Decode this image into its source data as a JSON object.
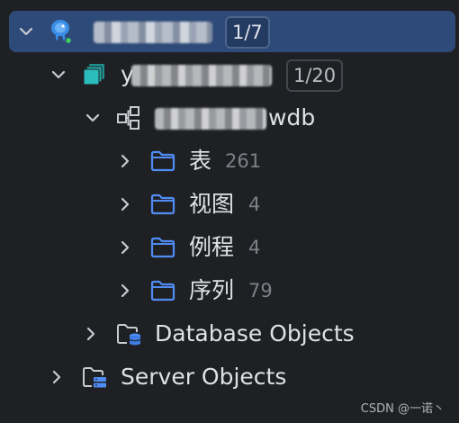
{
  "tree": {
    "connection": {
      "name_redacted": true,
      "badge": "1/7",
      "icon": "postgresql-elephant-icon",
      "status": "connected"
    },
    "database": {
      "name_prefix": "y",
      "name_redacted": true,
      "badge": "1/20",
      "icon": "database-stack-icon"
    },
    "schema": {
      "name_suffix": "wdb",
      "name_redacted": true,
      "icon": "schema-icon"
    },
    "folders": [
      {
        "label": "表",
        "count": "261"
      },
      {
        "label": "视图",
        "count": "4"
      },
      {
        "label": "例程",
        "count": "4"
      },
      {
        "label": "序列",
        "count": "79"
      }
    ],
    "database_objects": {
      "label": "Database Objects"
    },
    "server_objects": {
      "label": "Server Objects"
    }
  },
  "colors": {
    "background": "#1f2024",
    "selected_row": "#2e4a78",
    "folder_blue": "#4f8df5",
    "text": "#dfe1e5",
    "count_text": "#7d8187"
  },
  "watermark": "CSDN @一诺丶"
}
